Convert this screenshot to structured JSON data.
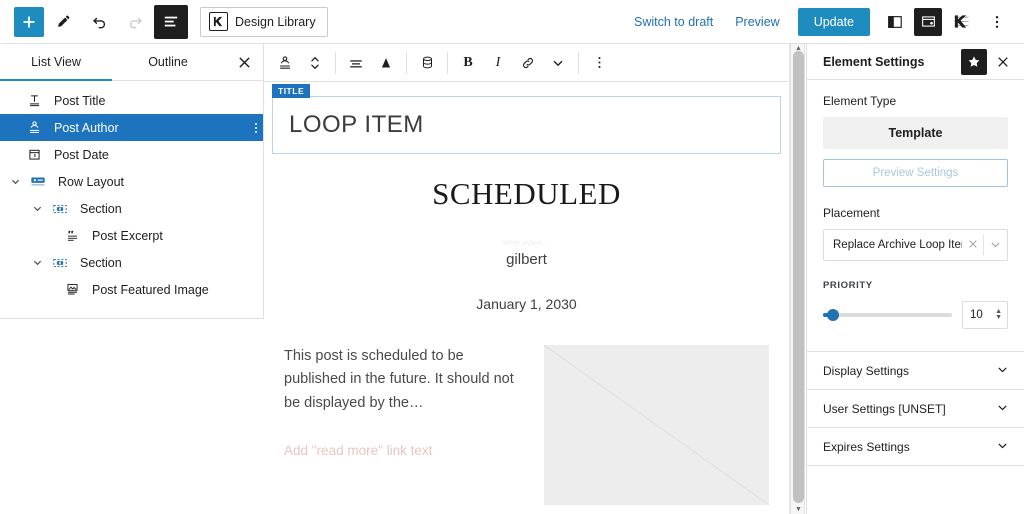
{
  "topbar": {
    "add_label": "+",
    "tools_icon": "pencil-icon",
    "undo_icon": "undo-icon",
    "redo_icon": "redo-icon",
    "listview_icon": "list-view-icon",
    "design_library_label": "Design Library",
    "design_library_icon": "kadence-icon",
    "switch_to_draft_label": "Switch to draft",
    "preview_label": "Preview",
    "update_label": "Update",
    "sidebar_toggle_icon": "sidebar-toggle-icon",
    "settings_icon": "settings-panel-icon",
    "kadence_icon": "kadence-blocks-icon",
    "more_icon": "more-options-icon"
  },
  "listview": {
    "tabs": [
      {
        "label": "List View",
        "active": true
      },
      {
        "label": "Outline",
        "active": false
      }
    ],
    "close_icon": "close-icon",
    "items": [
      {
        "label": "Post Title",
        "icon": "post-title-icon",
        "indent": 0,
        "twisty": "",
        "selected": false,
        "dots": false
      },
      {
        "label": "Post Author",
        "icon": "post-author-icon",
        "indent": 0,
        "twisty": "",
        "selected": true,
        "dots": true
      },
      {
        "label": "Post Date",
        "icon": "post-date-icon",
        "indent": 0,
        "twisty": "",
        "selected": false,
        "dots": false
      },
      {
        "label": "Row Layout",
        "icon": "row-layout-icon",
        "indent": 1,
        "twisty": "v",
        "selected": false,
        "dots": false
      },
      {
        "label": "Section",
        "icon": "section-icon",
        "indent": 2,
        "twisty": "v",
        "selected": false,
        "dots": false
      },
      {
        "label": "Post Excerpt",
        "icon": "post-excerpt-icon",
        "indent": 3,
        "twisty": "",
        "selected": false,
        "dots": false
      },
      {
        "label": "Section",
        "icon": "section-icon",
        "indent": 2,
        "twisty": "v",
        "selected": false,
        "dots": false
      },
      {
        "label": "Post Featured Image",
        "icon": "post-featured-image-icon",
        "indent": 3,
        "twisty": "",
        "selected": false,
        "dots": false
      }
    ]
  },
  "block_toolbar": {
    "block_type_icon": "post-author-icon",
    "move_icon": "move-up-down-icon",
    "align_icon": "align-text-icon",
    "typography_icon": "typography-icon",
    "database_icon": "dynamic-content-icon",
    "bold_label": "B",
    "italic_label": "I",
    "link_icon": "link-icon",
    "more_formats_icon": "chevron-down-icon",
    "options_icon": "more-options-icon"
  },
  "canvas": {
    "title_badge": "TITLE",
    "title_value": "LOOP ITEM",
    "preview": {
      "heading": "SCHEDULED",
      "byline_placeholder": "Write byline…",
      "author": "gilbert",
      "date": "January 1, 2030",
      "excerpt": "This post is scheduled to be published in the future. It should not be displayed by the…",
      "read_more_placeholder": "Add \"read more\" link text",
      "featured_image_alt": "featured-image-placeholder"
    }
  },
  "sidebar": {
    "title": "Element Settings",
    "star_icon": "star-icon",
    "close_icon": "close-icon",
    "element_type_label": "Element Type",
    "element_type_value": "Template",
    "preview_settings_label": "Preview Settings",
    "placement_label": "Placement",
    "placement_value": "Replace Archive Loop Item...",
    "placement_clear_icon": "clear-icon",
    "placement_caret_icon": "chevron-down-icon",
    "priority_label": "PRIORITY",
    "priority_value": "10",
    "accordions": [
      {
        "label": "Display Settings",
        "caret": "chevron-down-icon"
      },
      {
        "label": "User Settings [UNSET]",
        "caret": "chevron-down-icon"
      },
      {
        "label": "Expires Settings",
        "caret": "chevron-down-icon"
      }
    ]
  },
  "colors": {
    "accent_blue": "#1e8cbe",
    "selected_blue": "#1e73be",
    "link_blue": "#2271b1",
    "border_gray": "#e0e0e0",
    "placeholder_pink": "#e5c8c0"
  }
}
